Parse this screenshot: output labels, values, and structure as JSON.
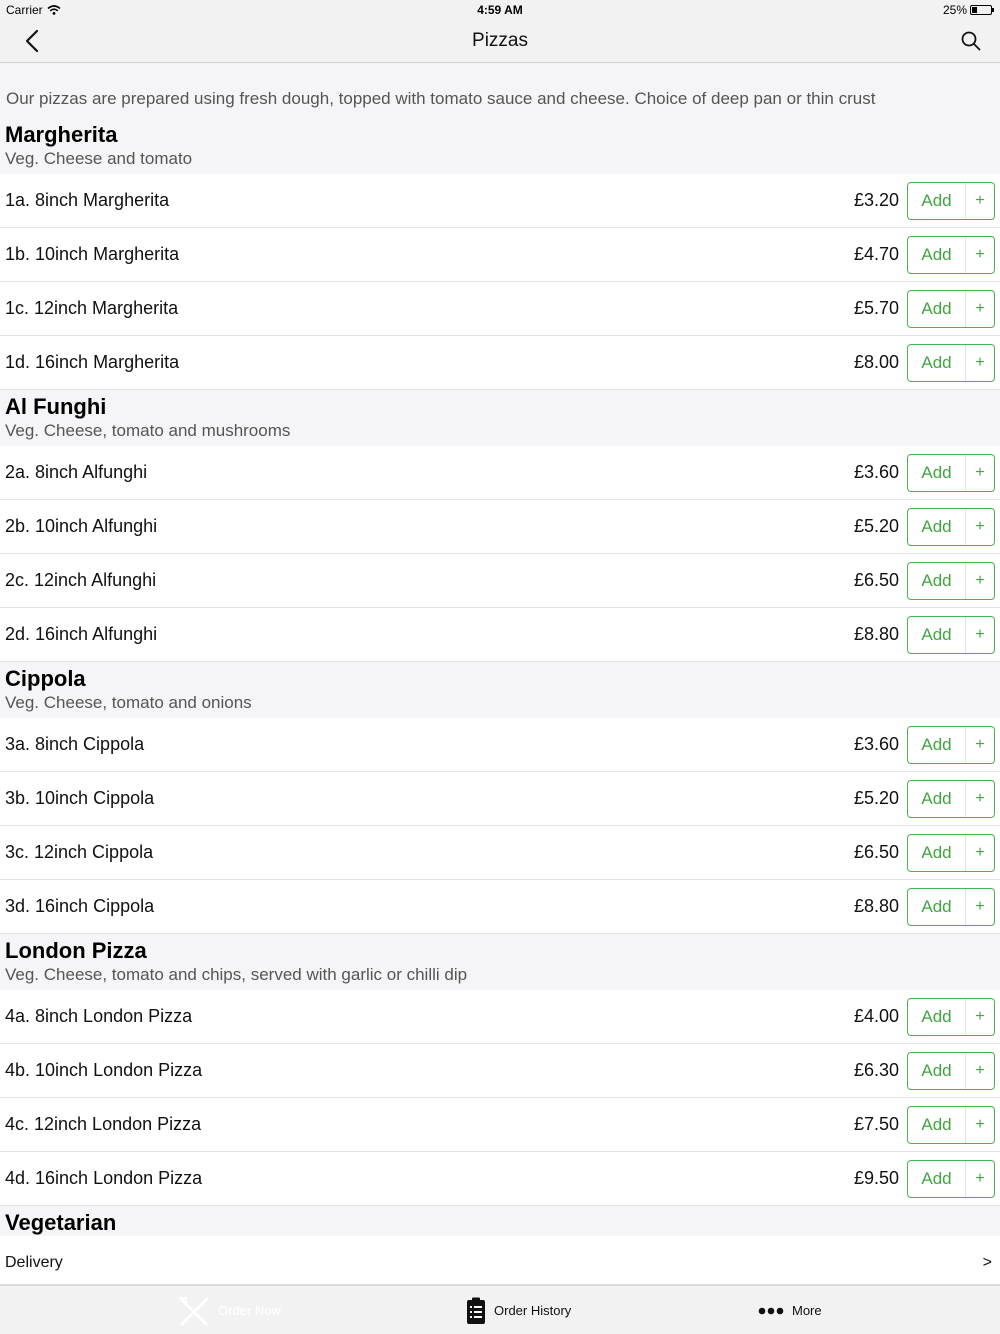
{
  "status_bar": {
    "carrier": "Carrier",
    "time": "4:59 AM",
    "battery": "25%"
  },
  "nav": {
    "title": "Pizzas"
  },
  "intro": "Our pizzas are prepared using fresh dough, topped with tomato sauce and cheese. Choice of deep pan or thin crust",
  "add_label": "Add",
  "plus_label": "+",
  "sections": [
    {
      "title": "Margherita",
      "description": "Veg. Cheese and tomato",
      "items": [
        {
          "name": "1a. 8inch Margherita",
          "price": "£3.20"
        },
        {
          "name": "1b. 10inch Margherita",
          "price": "£4.70"
        },
        {
          "name": "1c. 12inch Margherita",
          "price": "£5.70"
        },
        {
          "name": "1d. 16inch Margherita",
          "price": "£8.00"
        }
      ]
    },
    {
      "title": "Al Funghi",
      "description": "Veg. Cheese, tomato and mushrooms",
      "items": [
        {
          "name": "2a. 8inch Alfunghi",
          "price": "£3.60"
        },
        {
          "name": "2b. 10inch Alfunghi",
          "price": "£5.20"
        },
        {
          "name": "2c. 12inch Alfunghi",
          "price": "£6.50"
        },
        {
          "name": "2d. 16inch Alfunghi",
          "price": "£8.80"
        }
      ]
    },
    {
      "title": "Cippola",
      "description": "Veg. Cheese, tomato and onions",
      "items": [
        {
          "name": "3a. 8inch Cippola",
          "price": "£3.60"
        },
        {
          "name": "3b. 10inch Cippola",
          "price": "£5.20"
        },
        {
          "name": "3c. 12inch Cippola",
          "price": "£6.50"
        },
        {
          "name": "3d. 16inch Cippola",
          "price": "£8.80"
        }
      ]
    },
    {
      "title": "London Pizza",
      "description": "Veg. Cheese, tomato and chips, served with garlic or chilli dip",
      "items": [
        {
          "name": "4a. 8inch London Pizza",
          "price": "£4.00"
        },
        {
          "name": "4b. 10inch London Pizza",
          "price": "£6.30"
        },
        {
          "name": "4c. 12inch London Pizza",
          "price": "£7.50"
        },
        {
          "name": "4d. 16inch London Pizza",
          "price": "£9.50"
        }
      ]
    },
    {
      "title": "Vegetarian",
      "description": "",
      "items": []
    }
  ],
  "delivery": {
    "label": "Delivery",
    "chevron": ">"
  },
  "tabs": [
    {
      "label": "Order Now",
      "icon": "fork-knife-icon"
    },
    {
      "label": "Order History",
      "icon": "clipboard-icon"
    },
    {
      "label": "More",
      "icon": "more-dots-icon"
    }
  ],
  "colors": {
    "accent_green": "#3fa63f",
    "header_bg": "#f5f5f7",
    "bar_bg": "#f2f2f2"
  }
}
